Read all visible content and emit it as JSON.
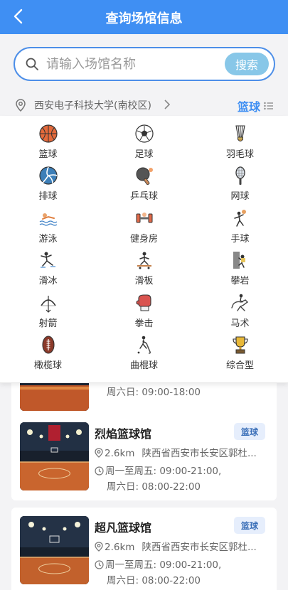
{
  "header": {
    "title": "查询场馆信息"
  },
  "search": {
    "placeholder": "请输入场馆名称",
    "value": "",
    "button_label": "搜索"
  },
  "location": {
    "campus": "西安电子科技大学(南校区)",
    "sport": "篮球"
  },
  "sports": [
    {
      "label": "篮球",
      "icon": "basketball-icon"
    },
    {
      "label": "足球",
      "icon": "soccer-ball-icon"
    },
    {
      "label": "羽毛球",
      "icon": "shuttlecock-icon"
    },
    {
      "label": "排球",
      "icon": "volleyball-icon"
    },
    {
      "label": "乒乓球",
      "icon": "ping-pong-icon"
    },
    {
      "label": "网球",
      "icon": "tennis-racket-icon"
    },
    {
      "label": "游泳",
      "icon": "swimmer-icon"
    },
    {
      "label": "健身房",
      "icon": "dumbbell-icon"
    },
    {
      "label": "手球",
      "icon": "handball-icon"
    },
    {
      "label": "滑冰",
      "icon": "ice-skater-icon"
    },
    {
      "label": "滑板",
      "icon": "skateboard-icon"
    },
    {
      "label": "攀岩",
      "icon": "climbing-icon"
    },
    {
      "label": "射箭",
      "icon": "bow-arrow-icon"
    },
    {
      "label": "拳击",
      "icon": "boxing-glove-icon"
    },
    {
      "label": "马术",
      "icon": "horse-rider-icon"
    },
    {
      "label": "橄榄球",
      "icon": "rugby-ball-icon"
    },
    {
      "label": "曲棍球",
      "icon": "hockey-stick-icon"
    },
    {
      "label": "综合型",
      "icon": "trophy-icon"
    }
  ],
  "venues": [
    {
      "name": "",
      "tag": "",
      "distance": "",
      "address": "",
      "weekday_hours": "",
      "weekend_hours": "周六日: 09:00-18:00"
    },
    {
      "name": "烈焰篮球馆",
      "tag": "篮球",
      "distance": "2.6km",
      "address": "陕西省西安市长安区郭杜...",
      "weekday_hours": "周一至周五: 09:00-21:00,",
      "weekend_hours": "周六日: 08:00-22:00"
    },
    {
      "name": "超凡篮球馆",
      "tag": "篮球",
      "distance": "2.6km",
      "address": "陕西省西安市长安区郭杜...",
      "weekday_hours": "周一至周五: 09:00-21:00,",
      "weekend_hours": "周六日: 08:00-22:00"
    }
  ],
  "colors": {
    "header_bg": "#3f8ff3",
    "accent": "#3f8ff3",
    "search_btn": "#88c7e8",
    "badge_bg": "#e6eefc"
  }
}
